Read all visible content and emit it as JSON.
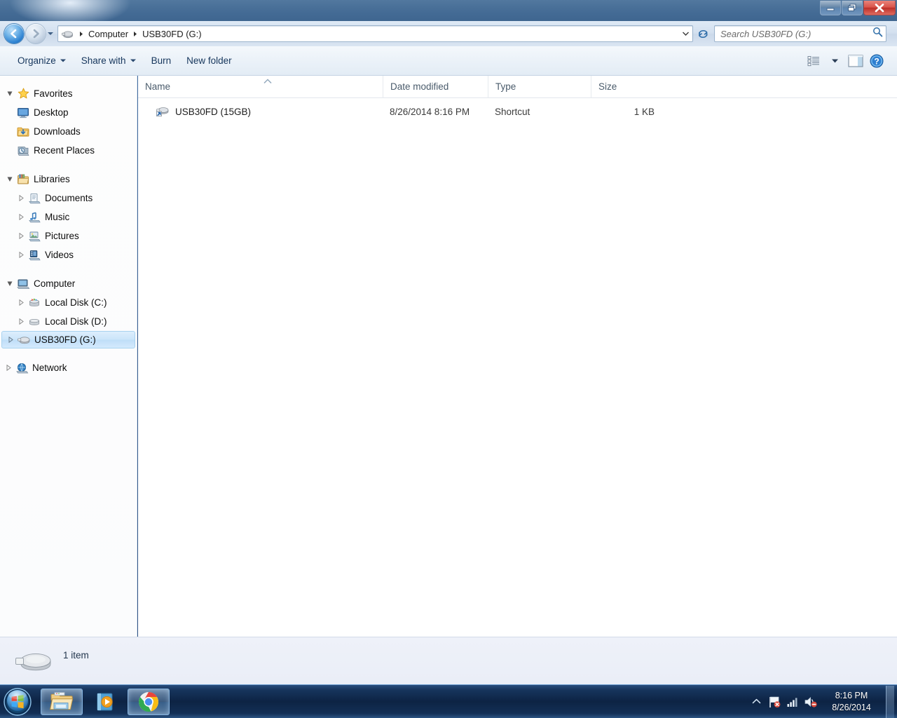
{
  "window": {
    "title": "",
    "controls": {
      "minimize": "Minimize",
      "restore": "Restore Down",
      "close": "Close"
    }
  },
  "addressbar": {
    "back_tooltip": "Back to Computer",
    "forward_tooltip": "Forward",
    "history_tooltip": "Recent Pages",
    "refresh_tooltip": "Refresh",
    "path_icon": "usb-drive-icon",
    "breadcrumbs": [
      "Computer",
      "USB30FD (G:)"
    ],
    "separator": "▶"
  },
  "search": {
    "placeholder": "Search USB30FD (G:)",
    "value": "",
    "icon": "search-icon"
  },
  "toolbar": {
    "items": [
      {
        "label": "Organize",
        "has_dropdown": true
      },
      {
        "label": "Share with",
        "has_dropdown": true
      },
      {
        "label": "Burn",
        "has_dropdown": false
      },
      {
        "label": "New folder",
        "has_dropdown": false
      }
    ],
    "view_button": "Change your view",
    "preview_button": "Show the preview pane",
    "help_button": "Get help"
  },
  "navpane": {
    "groups": [
      {
        "name": "Favorites",
        "icon": "star-icon",
        "expanded": true,
        "twisty": "expanded",
        "children": [
          {
            "label": "Desktop",
            "icon": "desktop-icon",
            "twisty": "none"
          },
          {
            "label": "Downloads",
            "icon": "downloads-folder-icon",
            "twisty": "none"
          },
          {
            "label": "Recent Places",
            "icon": "recent-places-icon",
            "twisty": "none"
          }
        ]
      },
      {
        "name": "Libraries",
        "icon": "libraries-icon",
        "expanded": true,
        "twisty": "expanded",
        "children": [
          {
            "label": "Documents",
            "icon": "documents-library-icon",
            "twisty": "collapsed"
          },
          {
            "label": "Music",
            "icon": "music-library-icon",
            "twisty": "collapsed"
          },
          {
            "label": "Pictures",
            "icon": "pictures-library-icon",
            "twisty": "collapsed"
          },
          {
            "label": "Videos",
            "icon": "videos-library-icon",
            "twisty": "collapsed"
          }
        ]
      },
      {
        "name": "Computer",
        "icon": "computer-icon",
        "expanded": true,
        "twisty": "expanded",
        "children": [
          {
            "label": "Local Disk (C:)",
            "icon": "system-drive-icon",
            "twisty": "collapsed"
          },
          {
            "label": "Local Disk (D:)",
            "icon": "hard-drive-icon",
            "twisty": "collapsed"
          },
          {
            "label": "USB30FD (G:)",
            "icon": "usb-drive-icon",
            "twisty": "collapsed",
            "selected": true
          }
        ]
      },
      {
        "name": "Network",
        "icon": "network-icon",
        "expanded": false,
        "twisty": "collapsed",
        "children": []
      }
    ]
  },
  "filelist": {
    "columns": [
      {
        "key": "name",
        "label": "Name",
        "sorted": "ascending"
      },
      {
        "key": "date",
        "label": "Date modified",
        "sorted": ""
      },
      {
        "key": "type",
        "label": "Type",
        "sorted": ""
      },
      {
        "key": "size",
        "label": "Size",
        "sorted": ""
      }
    ],
    "rows": [
      {
        "name": "USB30FD (15GB)",
        "date": "8/26/2014 8:16 PM",
        "type": "Shortcut",
        "size": "1 KB",
        "icon": "usb-drive-shortcut-icon"
      }
    ]
  },
  "statusbar": {
    "icon": "usb-drive-icon",
    "text": "1 item"
  },
  "taskbar": {
    "start_button": "Start",
    "buttons": [
      {
        "name": "windows-explorer",
        "icon": "folder-icon",
        "active": true
      },
      {
        "name": "windows-media-player",
        "icon": "media-player-icon",
        "active": false
      },
      {
        "name": "google-chrome",
        "icon": "chrome-icon",
        "active": true
      }
    ],
    "tray": {
      "show_hidden": "Show hidden icons",
      "action_center": "Action Center - solve PC issues",
      "network": "Network access",
      "volume": "Volume muted",
      "time": "8:16 PM",
      "date": "8/26/2014"
    },
    "show_desktop": "Show desktop"
  },
  "colors": {
    "accent": "#2a7fd0",
    "selection": "#cbe5fa",
    "close_button": "#d9534a",
    "taskbar": "#0c2242"
  }
}
